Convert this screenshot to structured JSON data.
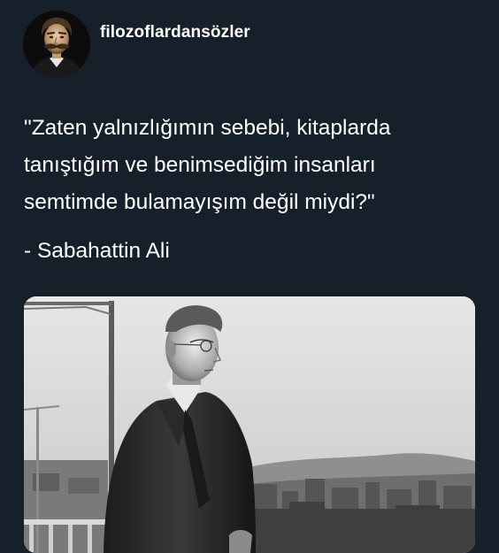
{
  "post": {
    "username": "filozoflardansözler",
    "quote_lines": [
      "\"Zaten yalnızlığımın sebebi, kitaplarda",
      "tanıştığım ve benimsediğim insanları",
      "semtimde bulamayışım değil miydi?\""
    ],
    "author": "- Sabahattin Ali"
  },
  "theme": {
    "background": "#15202b",
    "text": "#ffffff"
  }
}
